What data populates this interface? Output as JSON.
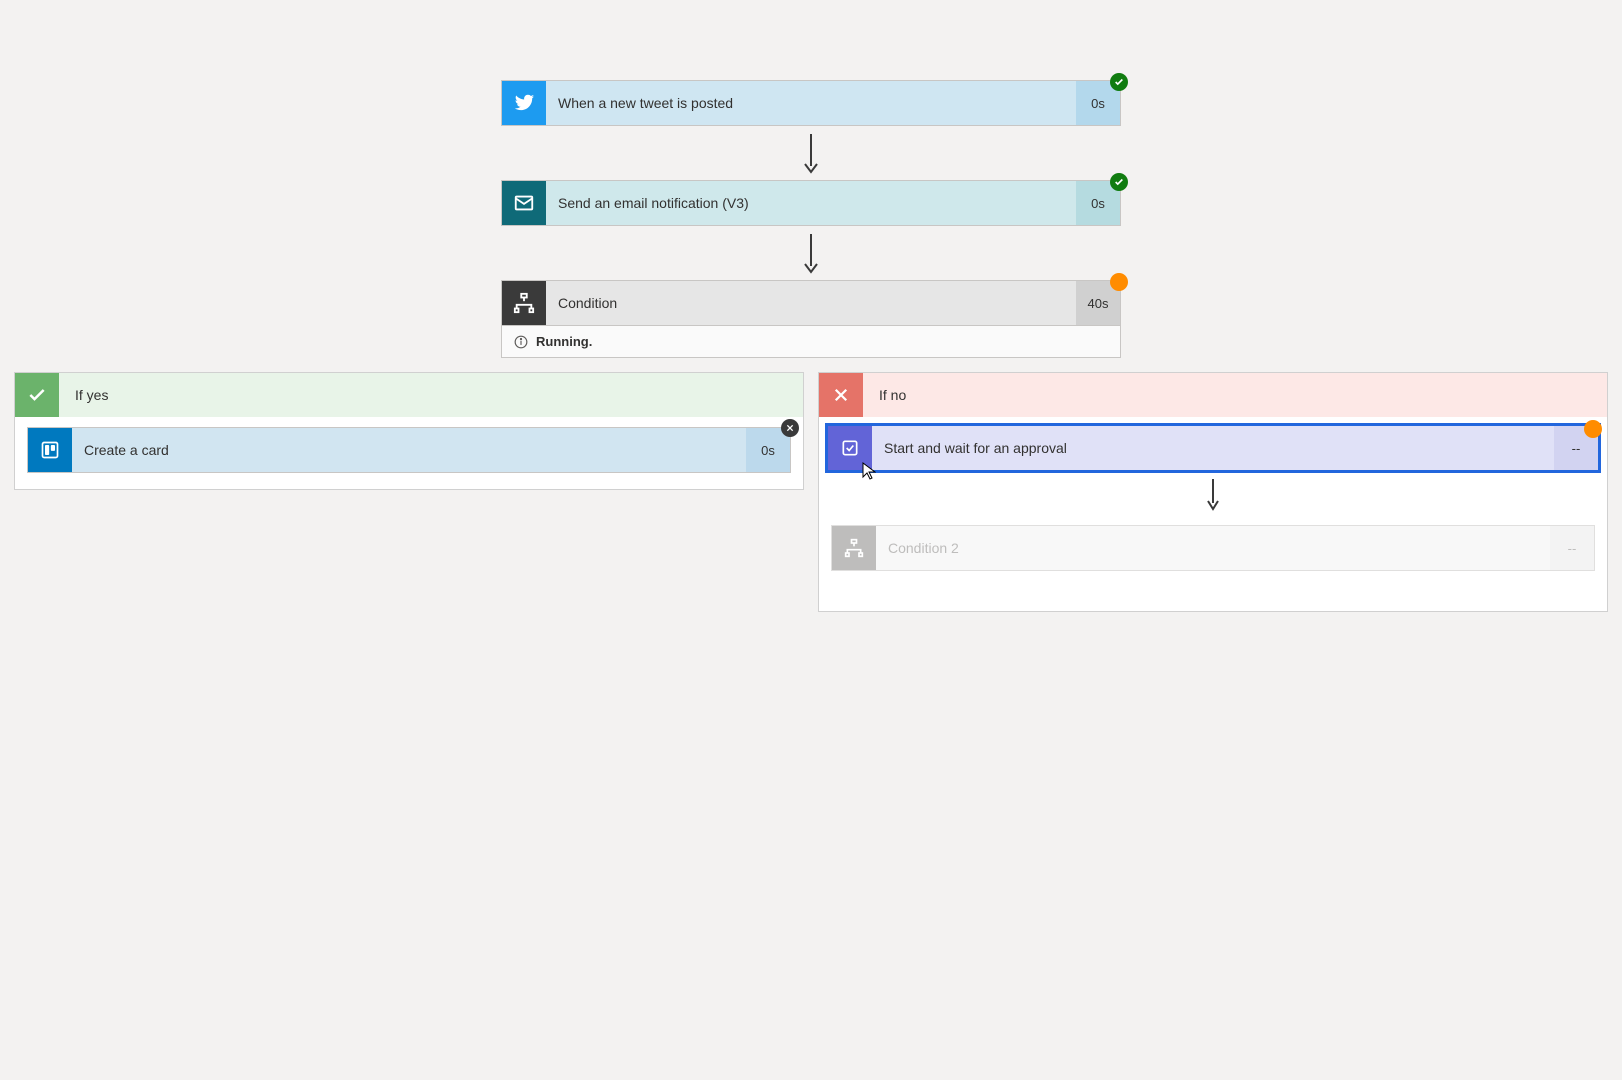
{
  "steps": {
    "trigger": {
      "title": "When a new tweet is posted",
      "duration": "0s",
      "status": "success"
    },
    "email": {
      "title": "Send an email notification (V3)",
      "duration": "0s",
      "status": "success"
    },
    "condition": {
      "title": "Condition",
      "duration": "40s",
      "status": "running",
      "status_text": "Running."
    }
  },
  "branches": {
    "yes": {
      "header": "If yes",
      "steps": {
        "trello": {
          "title": "Create a card",
          "duration": "0s",
          "badge": "close"
        }
      }
    },
    "no": {
      "header": "If no",
      "steps": {
        "approval": {
          "title": "Start and wait for an approval",
          "duration": "--",
          "status": "running",
          "selected": true
        },
        "condition2": {
          "title": "Condition 2",
          "duration": "--",
          "disabled": true
        }
      }
    }
  }
}
